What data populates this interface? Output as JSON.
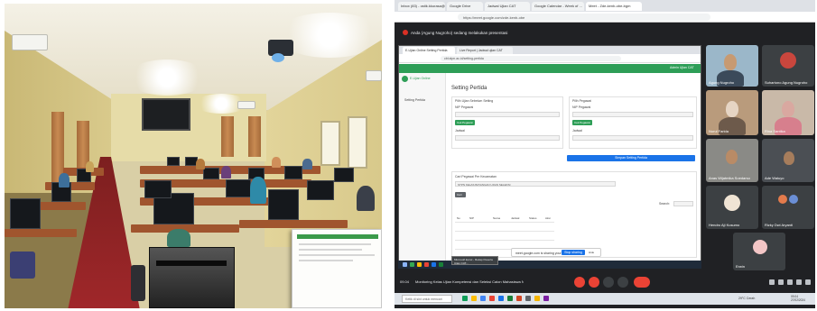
{
  "meeting": {
    "presenting_text": "Anda (Agung Nugroho) sedang melakukan presentasi",
    "meeting_code": "09.04",
    "meeting_title": "Monitoring Kelas Ujian Kompetensi dan Seleksi Calon Mahasiswa NPP 2024"
  },
  "browser": {
    "tabs": [
      "Inbox (83) - ostik.kkurasa@...",
      "Google Drive",
      "Jadwal Ujian CAT",
      "Google Calendar - Week of ...",
      "Meet - Zde-kenb-obe-bgm"
    ],
    "url": "https://meet.google.com/zde-kenb-obe"
  },
  "shared_screen": {
    "tabs": [
      "E-Ujian Online Setting Pertida",
      "Live Report | Jadwal ujian CAT"
    ],
    "url": "cbt.stpn.ac.id/setting-pertida",
    "header_right": "Admin Ujian CAT",
    "logo_text": "E-Ujian Online",
    "sidebar_item": "Setting Pertida",
    "heading": "Setting Pertida",
    "card1_title": "Pilih Ujian Sebelum Setting",
    "card1_label": "NIP Pegawai",
    "card1_btn": "Cek Pegawai",
    "card1_label2": "Jadwal",
    "card2_title": "Pilih Pegawai",
    "card2_label": "NIP Pegawai",
    "card2_btn": "Cek Pegawai",
    "card2_label2": "Jadwal",
    "wide_btn": "Simpan Setting Pertida",
    "filter_label": "Cari Pegawai Per Kecamatan",
    "filter_value": "STPN KELAS BAYANGAN UJIAN SELEKSI",
    "small_btn": "Cari",
    "search_label": "Search:",
    "col_no": "No",
    "col_nip": "NIP",
    "col_nama": "Nama",
    "col_jadwal": "Jadwal",
    "col_status": "Status",
    "col_aksi": "Aksi",
    "stop_text": "meet.google.com is sharing your screen.",
    "stop_btn": "Stop sharing",
    "hide_btn": "Hide",
    "tooltip": "Microsoft Excel - Rekap Peserta Ujian CAT..."
  },
  "participants": [
    {
      "name": "Agung Nugroho"
    },
    {
      "name": "Suhartono Agung Nugroho"
    },
    {
      "name": "Nurul Farida"
    },
    {
      "name": "Rina Santika"
    },
    {
      "name": "Anas Wijatmika Soedarso"
    },
    {
      "name": "Ade Waluyo"
    },
    {
      "name": "Hendro Aji Kusumo"
    },
    {
      "name": "Rizky Dwi Aryanti"
    },
    {
      "name": "Dwi Jiwandono"
    },
    {
      "name": "Erwin"
    }
  ],
  "windows_taskbar": {
    "search_placeholder": "Ketik di sini untuk mencari",
    "weather": "29°C Cerah",
    "time": "09.04",
    "date": "27/02/2024"
  }
}
